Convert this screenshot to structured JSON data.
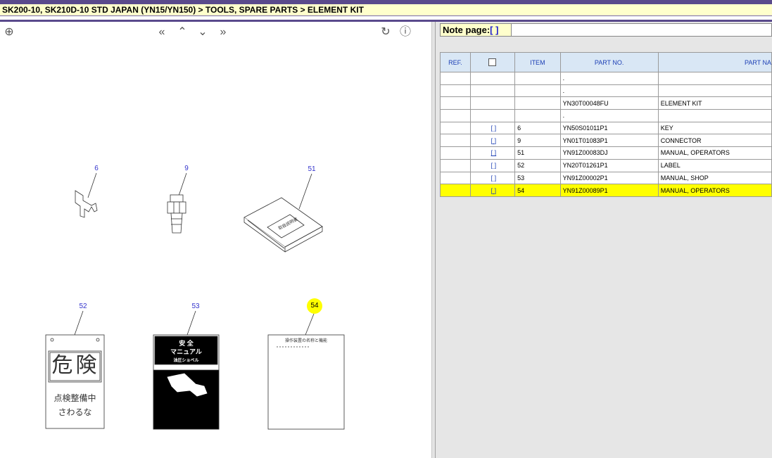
{
  "title": "SK200-10, SK210D-10 STD JAPAN (YN15/YN150) > TOOLS, SPARE PARTS > ELEMENT KIT",
  "toolbar": {
    "zoom_icon": "⊕",
    "first_icon": "«",
    "prev_icon": "⌃",
    "next_icon": "⌄",
    "last_icon": "»",
    "refresh_icon": "↻",
    "info_icon": "ⓘ"
  },
  "callouts": [
    "6",
    "9",
    "51",
    "52",
    "53",
    "54"
  ],
  "highlighted_callout": "54",
  "drawing_text": {
    "label52_line1": "危険",
    "label52_line2": "点検整備中",
    "label52_line3": "さわるな",
    "manual53_line1": "安 全",
    "manual53_line2": "マニュアル",
    "manual53_line3": "油圧ショベル",
    "manual54_heading": "操作装置の名称と機能",
    "manual51_label": "取扱説明書"
  },
  "note_page": {
    "label": "Note page:",
    "bracket": "[   ]"
  },
  "table": {
    "headers": {
      "ref": "REF.",
      "item": "ITEM",
      "part_no": "PART NO.",
      "part_name": "PART NA"
    },
    "rows": [
      {
        "book": "",
        "item": "",
        "part_no": ".",
        "part_name": ""
      },
      {
        "book": "",
        "item": "",
        "part_no": ".",
        "part_name": ""
      },
      {
        "book": "",
        "item": "",
        "part_no": "YN30T00048FU",
        "part_name": "ELEMENT KIT"
      },
      {
        "book": "",
        "item": "",
        "part_no": ".",
        "part_name": ""
      },
      {
        "book": "[  ]",
        "item": "6",
        "part_no": "YN50S01011P1",
        "part_name": "KEY"
      },
      {
        "book": "[  ]",
        "item": "9",
        "part_no": "YN01T01083P1",
        "part_name": "CONNECTOR"
      },
      {
        "book": "[  ]",
        "item": "51",
        "part_no": "YN91Z00083DJ",
        "part_name": "MANUAL, OPERATORS"
      },
      {
        "book": "[  ]",
        "item": "52",
        "part_no": "YN20T01261P1",
        "part_name": "LABEL"
      },
      {
        "book": "[  ]",
        "item": "53",
        "part_no": "YN91Z00002P1",
        "part_name": "MANUAL, SHOP"
      },
      {
        "book": "[  ]",
        "item": "54",
        "part_no": "YN91Z00089P1",
        "part_name": "MANUAL, OPERATORS"
      }
    ],
    "selected_item": "54"
  },
  "colors": {
    "title_bg": "#ffffcc",
    "accent": "#5a4a8c",
    "header_bg": "#d9e7f5",
    "header_text": "#1c3fb5",
    "highlight": "#ffff00"
  }
}
